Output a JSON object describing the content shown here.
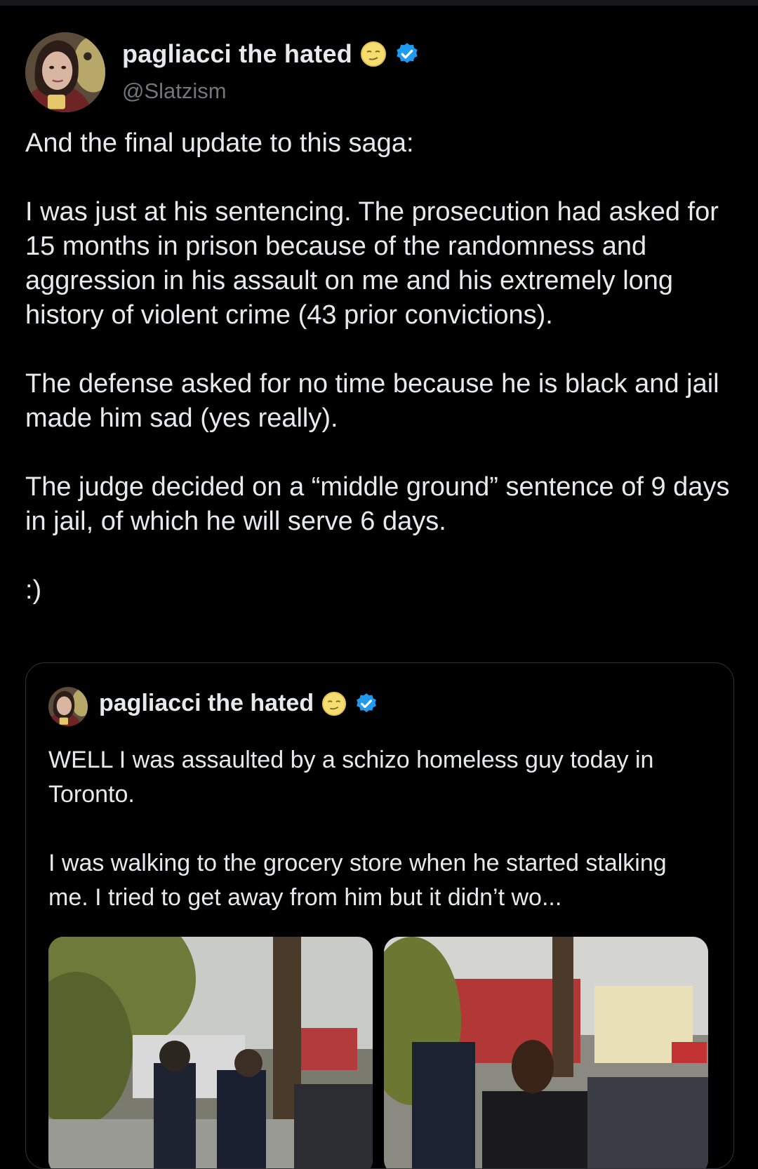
{
  "tweet": {
    "author": {
      "display_name": "pagliacci the hated",
      "handle": "@Slatzism",
      "emoji": "smug-moon-face-emoji",
      "verified": true,
      "verified_color": "#1d9bf0"
    },
    "paragraphs": [
      "And the final update to this saga:",
      "I was just at his sentencing. The prosecution had asked for 15 months in prison because of the randomness and aggression in his assault on me and his extremely long history of violent crime (43 prior convictions).",
      "The defense asked for no time because he is black and jail made him sad (yes really).",
      "The judge decided on a “middle ground” sentence of 9 days in jail, of which he will serve 6 days.",
      ":)"
    ]
  },
  "quoted_tweet": {
    "author": {
      "display_name": "pagliacci the hated",
      "emoji": "smug-moon-face-emoji",
      "verified": true
    },
    "paragraphs": [
      "WELL I was assaulted by a schizo homeless guy today in Toronto.",
      "I was walking to the grocery store when he started stalking me. I tried to get away from him but it didn’t wo..."
    ],
    "media": [
      {
        "kind": "photo",
        "subject": "police officers restraining a man on a street"
      },
      {
        "kind": "photo",
        "subject": "man standing near police officer and parked cars"
      }
    ]
  },
  "colors": {
    "background": "#000000",
    "text_primary": "#e7e9ea",
    "text_secondary": "#71767b",
    "border": "#2f3336",
    "accent": "#1d9bf0"
  }
}
